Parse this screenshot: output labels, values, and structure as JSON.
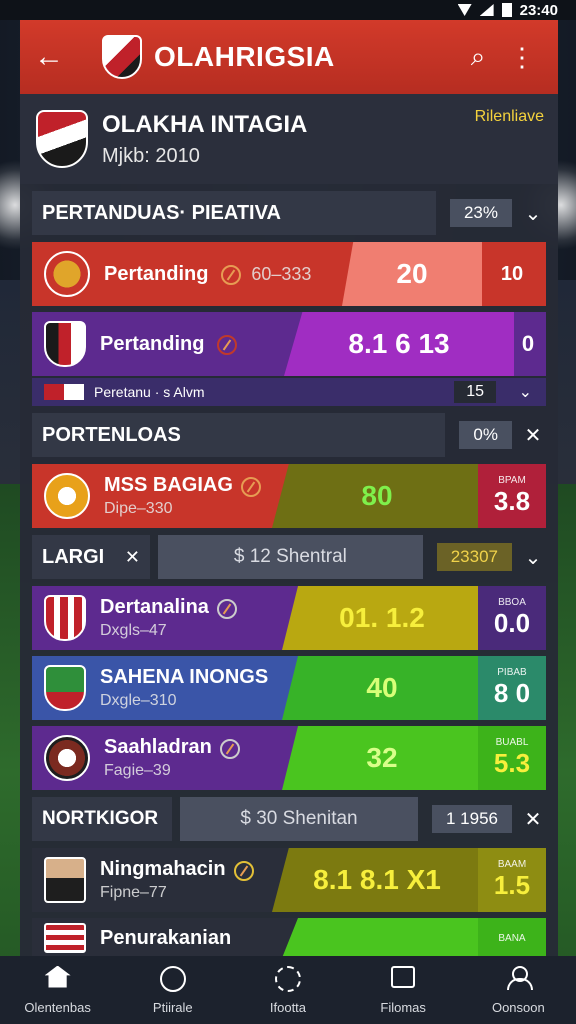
{
  "status_bar": {
    "time": "23:40"
  },
  "app_bar": {
    "title": "OLAHRIGSIA"
  },
  "team_header": {
    "name": "OLAKHA INTAGIA",
    "subtitle": "Mjkb: 2010",
    "tag": "Rilenliave"
  },
  "sections": [
    {
      "label": "PERTANDUAS· PIEATIVA",
      "pct": "23%"
    },
    {
      "label": "PORTENLOAS",
      "pct": "0%"
    },
    {
      "label": "LARGI",
      "money": "$ 12 Shentral",
      "value": "23307"
    },
    {
      "label": "NORTKIGOR",
      "money": "$ 30 Shenitan",
      "value": "1 1956"
    }
  ],
  "rows": [
    {
      "team": "Pertanding",
      "meta": "60–333",
      "score": "20",
      "end_value": "10"
    },
    {
      "team": "Pertanding",
      "meta": "",
      "score": "8.1   6  13",
      "end_value": "0"
    },
    {
      "team": "MSS BAGIAG",
      "meta": "Dipe–330",
      "score": "80",
      "end_mini": "BPAM",
      "end_value": "3.8"
    },
    {
      "team": "Dertanalina",
      "meta": "Dxgls–47",
      "score": "01.   1.2",
      "end_mini": "BBOA",
      "end_value": "0.0"
    },
    {
      "team": "SAHENA INONGS",
      "meta": "Dxgle–310",
      "score": "40",
      "end_mini": "PIBAB",
      "end_value": "8 0"
    },
    {
      "team": "Saahladran",
      "meta": "Fagie–39",
      "score": "32",
      "end_mini": "BUABL",
      "end_value": "5.3"
    },
    {
      "team": "Ningmahacin",
      "meta": "Fipne–77",
      "score": "8.1   8.1  X1",
      "end_mini": "BAAM",
      "end_value": "1.5"
    },
    {
      "team": "Penurakanian",
      "meta": "",
      "score": "",
      "end_mini": "BANA",
      "end_value": ""
    }
  ],
  "subrow": {
    "label": "Peretanu · s Alvm",
    "num": "15"
  },
  "nav": [
    {
      "label": "Olentenbas"
    },
    {
      "label": "Ptiirale"
    },
    {
      "label": "Ifootta"
    },
    {
      "label": "Filomas"
    },
    {
      "label": "Oonsoon"
    }
  ],
  "colors": {
    "accent_red": "#c8352a",
    "purple": "#5d2a8f",
    "lime": "#4ac51f",
    "olive": "#a39a0e"
  }
}
